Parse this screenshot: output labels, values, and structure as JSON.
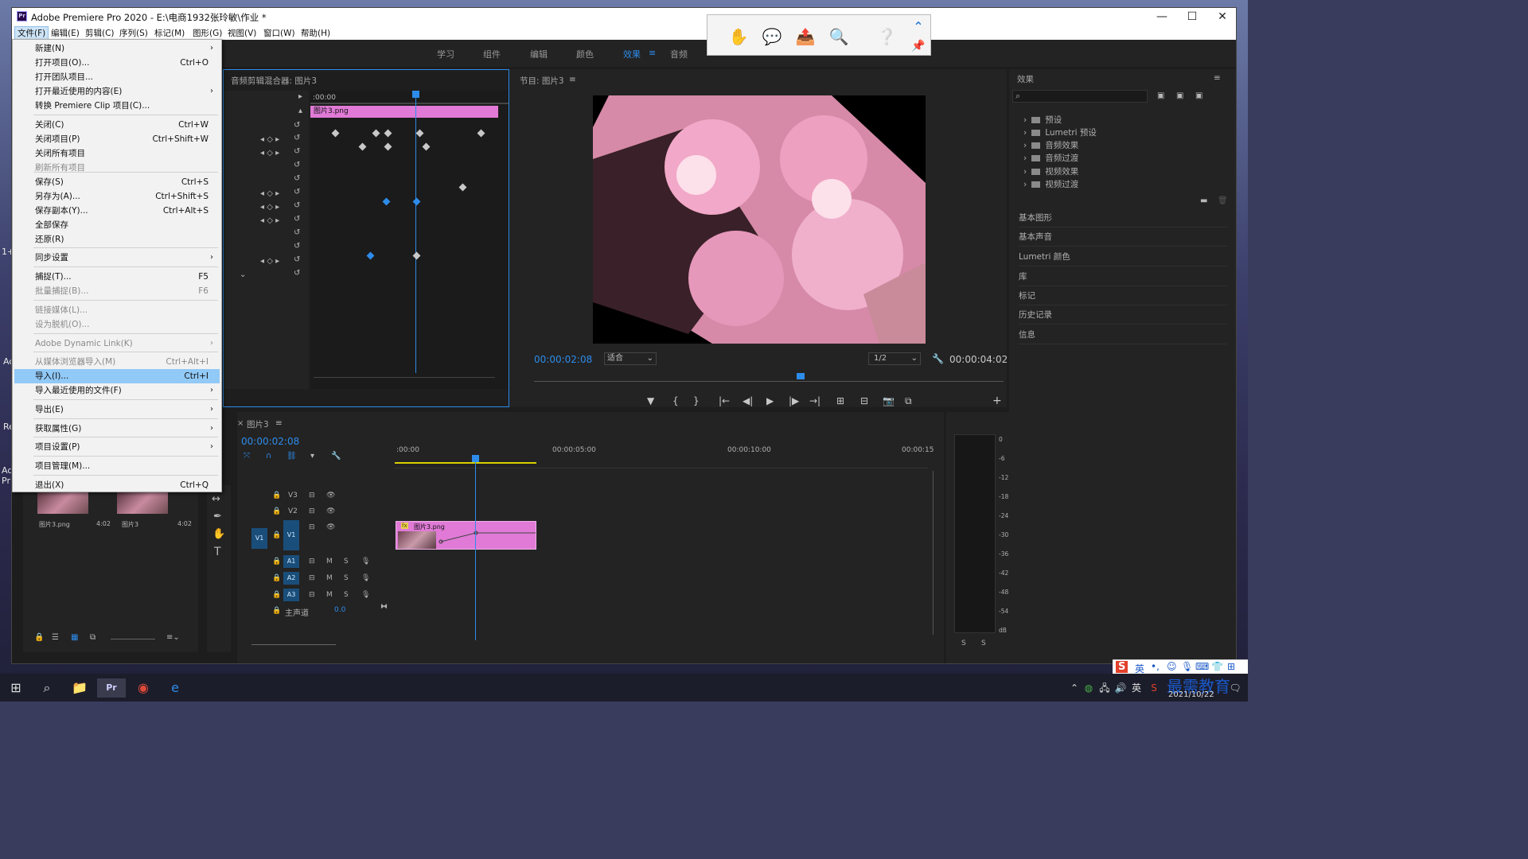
{
  "window": {
    "title": "Adobe Premiere Pro 2020 - E:\\电商1932张玲敏\\作业 *",
    "app_icon": "Pr",
    "controls": {
      "minimize": "—",
      "maximize": "☐",
      "close": "✕"
    }
  },
  "menubar": [
    {
      "label": "文件(F)",
      "active": true
    },
    {
      "label": "编辑(E)"
    },
    {
      "label": "剪辑(C)"
    },
    {
      "label": "序列(S)"
    },
    {
      "label": "标记(M)"
    },
    {
      "label": "图形(G)"
    },
    {
      "label": "视图(V)"
    },
    {
      "label": "窗口(W)"
    },
    {
      "label": "帮助(H)"
    }
  ],
  "workspaces": {
    "learn": "学习",
    "assembly": "组件",
    "editing": "编辑",
    "color": "颜色",
    "effects": "效果",
    "effects_menu": "≡",
    "audio": "音频"
  },
  "file_menu": {
    "items": [
      {
        "label": "新建(N)",
        "arrow": "›"
      },
      {
        "label": "打开项目(O)...",
        "shortcut": "Ctrl+O"
      },
      {
        "label": "打开团队项目..."
      },
      {
        "label": "打开最近使用的内容(E)",
        "arrow": "›"
      },
      {
        "label": "转换 Premiere Clip 项目(C)..."
      },
      {
        "label": "关闭(C)",
        "shortcut": "Ctrl+W"
      },
      {
        "label": "关闭项目(P)",
        "shortcut": "Ctrl+Shift+W"
      },
      {
        "label": "关闭所有项目"
      },
      {
        "label": "刷新所有项目",
        "disabled": true
      },
      {
        "label": "保存(S)",
        "shortcut": "Ctrl+S"
      },
      {
        "label": "另存为(A)...",
        "shortcut": "Ctrl+Shift+S"
      },
      {
        "label": "保存副本(Y)...",
        "shortcut": "Ctrl+Alt+S"
      },
      {
        "label": "全部保存"
      },
      {
        "label": "还原(R)"
      },
      {
        "label": "同步设置",
        "arrow": "›"
      },
      {
        "label": "捕捉(T)...",
        "shortcut": "F5"
      },
      {
        "label": "批量捕捉(B)...",
        "shortcut": "F6",
        "disabled": true
      },
      {
        "label": "链接媒体(L)...",
        "disabled": true
      },
      {
        "label": "设为脱机(O)...",
        "disabled": true
      },
      {
        "label": "Adobe Dynamic Link(K)",
        "arrow": "›",
        "disabled": true
      },
      {
        "label": "从媒体浏览器导入(M)",
        "shortcut": "Ctrl+Alt+I",
        "disabled": true
      },
      {
        "label": "导入(I)...",
        "shortcut": "Ctrl+I",
        "highlighted": true
      },
      {
        "label": "导入最近使用的文件(F)",
        "arrow": "›"
      },
      {
        "label": "导出(E)",
        "arrow": "›"
      },
      {
        "label": "获取属性(G)",
        "arrow": "›"
      },
      {
        "label": "项目设置(P)",
        "arrow": "›"
      },
      {
        "label": "项目管理(M)..."
      },
      {
        "label": "退出(X)",
        "shortcut": "Ctrl+Q"
      }
    ]
  },
  "audio_mixer": {
    "title": "音频剪辑混合器: 图片3",
    "ruler_start": ":00:00",
    "clip_name": "图片3.png"
  },
  "program_monitor": {
    "title": "节目: 图片3",
    "menu": "≡",
    "current_time": "00:00:02:08",
    "fit": "适合",
    "resolution": "1/2",
    "duration": "00:00:04:02",
    "controls": [
      "▼",
      "{",
      "}",
      "|←",
      "◀|",
      "▶",
      "|▶",
      "→|",
      "⊞",
      "⊟",
      "📷",
      "⧉",
      "+"
    ]
  },
  "effects_panel": {
    "title": "效果",
    "menu": "≡",
    "search_icon": "⌕",
    "folders": [
      "预设",
      "Lumetri 预设",
      "音频效果",
      "音频过渡",
      "视频效果",
      "视频过渡"
    ],
    "sections": [
      "基本图形",
      "基本声音",
      "Lumetri 颜色",
      "库",
      "标记",
      "历史记录",
      "信息"
    ]
  },
  "project_panel": {
    "items": [
      {
        "name": "图片3.png",
        "duration": "4:02"
      },
      {
        "name": "图片3",
        "duration": "4:02"
      }
    ]
  },
  "timeline": {
    "tab": "图片3",
    "close": "×",
    "menu": "≡",
    "current_time": "00:00:02:08",
    "ruler": [
      ":00:00",
      "00:00:05:00",
      "00:00:10:00",
      "00:00:15"
    ],
    "video_tracks": [
      "V3",
      "V2",
      "V1"
    ],
    "source_patch": "V1",
    "audio_tracks": [
      "A1",
      "A2",
      "A3"
    ],
    "track_m": "M",
    "track_s": "S",
    "master_label": "主声道",
    "master_value": "0.0",
    "clip_name": "图片3.png",
    "clip_fx": "fx"
  },
  "meter": {
    "scale": [
      "0",
      "-6",
      "-12",
      "-18",
      "-24",
      "-30",
      "-36",
      "-42",
      "-48",
      "-54",
      "dB"
    ],
    "solo_left": "S",
    "solo_right": "S"
  },
  "desktop": {
    "fragments": [
      "Ac",
      "Re",
      "Ad",
      "Pr",
      "1+"
    ]
  },
  "taskbar": {
    "time": "",
    "date": "2021/10/22",
    "watermark": "最需教育"
  },
  "ime_bar": {
    "logo": "S",
    "lang": "英"
  },
  "colors": {
    "accent": "#2d8ceb",
    "clip": "#e07ad6",
    "menu_highlight": "#91c9f7"
  }
}
